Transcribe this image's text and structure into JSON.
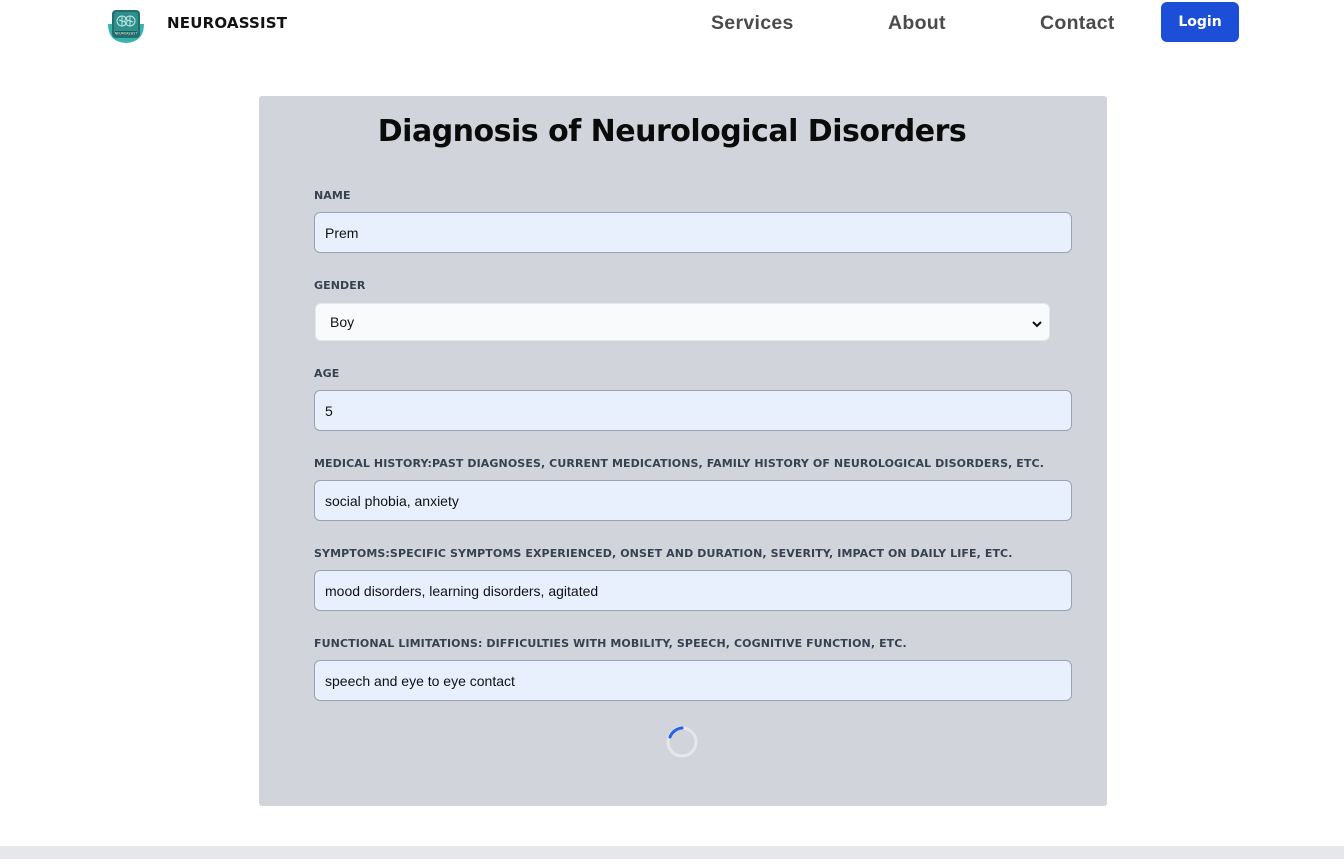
{
  "nav": {
    "brand": "NEUROASSIST",
    "logo_text": "NEUROASSIST",
    "links": [
      "Services",
      "About",
      "Contact"
    ],
    "login_label": "Login"
  },
  "form": {
    "title": "Diagnosis of Neurological Disorders",
    "fields": {
      "name": {
        "label": "NAME",
        "value": "Prem"
      },
      "gender": {
        "label": "GENDER",
        "value": "Boy"
      },
      "age": {
        "label": "AGE",
        "value": "5"
      },
      "medical_history": {
        "label": "MEDICAL HISTORY:PAST DIAGNOSES, CURRENT MEDICATIONS, FAMILY HISTORY OF NEUROLOGICAL DISORDERS, ETC.",
        "value": "social phobia, anxiety"
      },
      "symptoms": {
        "label": "SYMPTOMS:SPECIFIC SYMPTOMS EXPERIENCED, ONSET AND DURATION, SEVERITY, IMPACT ON DAILY LIFE, ETC.",
        "value": "mood disorders, learning disorders, agitated"
      },
      "functional_limitations": {
        "label": "FUNCTIONAL LIMITATIONS: DIFFICULTIES WITH MOBILITY, SPEECH, COGNITIVE FUNCTION, ETC.",
        "value": "speech and eye to eye contact"
      }
    }
  },
  "colors": {
    "accent": "#1d4ed8",
    "card_bg": "#d1d5db",
    "input_bg": "#e8f0fe",
    "logo_teal": "#3ab3b0"
  },
  "icons": {
    "logo": "brain-logo-icon",
    "select": "chevron-down-icon",
    "loading": "spinner-icon"
  }
}
